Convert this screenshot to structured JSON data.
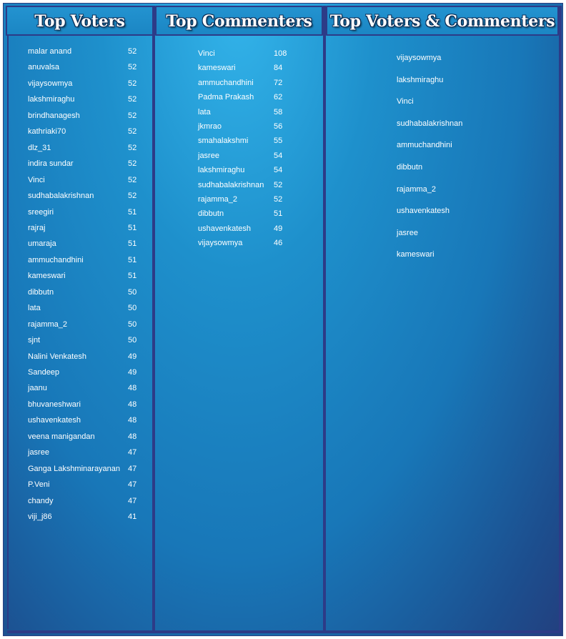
{
  "colors": {
    "frame": "#2d3b87",
    "background_top": "#33b4ea",
    "background_bottom": "#233f7e",
    "text": "#ffffff"
  },
  "top_voters": {
    "title": "Top Voters",
    "rows": [
      {
        "name": "malar anand",
        "count": "52"
      },
      {
        "name": "anuvalsa",
        "count": "52"
      },
      {
        "name": "vijaysowmya",
        "count": "52"
      },
      {
        "name": "lakshmiraghu",
        "count": "52"
      },
      {
        "name": "brindhanagesh",
        "count": "52"
      },
      {
        "name": "kathriaki70",
        "count": "52"
      },
      {
        "name": "dlz_31",
        "count": "52"
      },
      {
        "name": "indira sundar",
        "count": "52"
      },
      {
        "name": "Vinci",
        "count": "52"
      },
      {
        "name": "sudhabalakrishnan",
        "count": "52"
      },
      {
        "name": "sreegiri",
        "count": "51"
      },
      {
        "name": "rajraj",
        "count": "51"
      },
      {
        "name": "umaraja",
        "count": "51"
      },
      {
        "name": "ammuchandhini",
        "count": "51"
      },
      {
        "name": "kameswari",
        "count": "51"
      },
      {
        "name": "dibbutn",
        "count": "50"
      },
      {
        "name": "lata",
        "count": "50"
      },
      {
        "name": "rajamma_2",
        "count": "50"
      },
      {
        "name": "sjnt",
        "count": "50"
      },
      {
        "name": "Nalini Venkatesh",
        "count": "49"
      },
      {
        "name": "Sandeep",
        "count": "49"
      },
      {
        "name": "jaanu",
        "count": "48"
      },
      {
        "name": "bhuvaneshwari",
        "count": "48"
      },
      {
        "name": "ushavenkatesh",
        "count": "48"
      },
      {
        "name": "veena manigandan",
        "count": "48"
      },
      {
        "name": "jasree",
        "count": "47"
      },
      {
        "name": "Ganga Lakshminarayanan",
        "count": "47"
      },
      {
        "name": "P.Veni",
        "count": "47"
      },
      {
        "name": "chandy",
        "count": "47"
      },
      {
        "name": "viji_j86",
        "count": "41"
      }
    ]
  },
  "top_commenters": {
    "title": "Top Commenters",
    "rows": [
      {
        "name": "Vinci",
        "count": "108"
      },
      {
        "name": "kameswari",
        "count": "84"
      },
      {
        "name": "ammuchandhini",
        "count": "72"
      },
      {
        "name": "Padma Prakash",
        "count": "62"
      },
      {
        "name": "lata",
        "count": "58"
      },
      {
        "name": "jkmrao",
        "count": "56"
      },
      {
        "name": "smahalakshmi",
        "count": "55"
      },
      {
        "name": "jasree",
        "count": "54"
      },
      {
        "name": "lakshmiraghu",
        "count": "54"
      },
      {
        "name": "sudhabalakrishnan",
        "count": "52"
      },
      {
        "name": "rajamma_2",
        "count": "52"
      },
      {
        "name": "dibbutn",
        "count": "51"
      },
      {
        "name": "ushavenkatesh",
        "count": "49"
      },
      {
        "name": "vijaysowmya",
        "count": "46"
      }
    ]
  },
  "top_voters_commenters": {
    "title": "Top Voters & Commenters",
    "rows": [
      {
        "name": "vijaysowmya"
      },
      {
        "name": "lakshmiraghu"
      },
      {
        "name": "Vinci"
      },
      {
        "name": "sudhabalakrishnan"
      },
      {
        "name": "ammuchandhini"
      },
      {
        "name": "dibbutn"
      },
      {
        "name": "rajamma_2"
      },
      {
        "name": "ushavenkatesh"
      },
      {
        "name": "jasree"
      },
      {
        "name": "kameswari"
      }
    ]
  }
}
